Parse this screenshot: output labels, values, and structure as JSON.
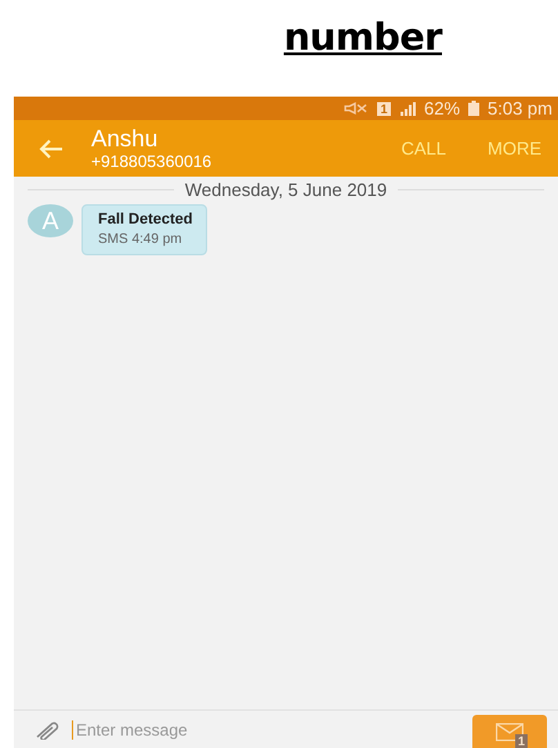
{
  "heading": "number",
  "status_bar": {
    "sim_slot": "1",
    "battery": "62%",
    "time": "5:03 pm"
  },
  "header": {
    "contact_name": "Anshu",
    "phone": "+918805360016",
    "actions": [
      "CALL",
      "MORE"
    ]
  },
  "date_separator": "Wednesday, 5 June 2019",
  "messages": [
    {
      "avatar": "A",
      "text": "Fall Detected",
      "meta": "SMS 4:49 pm"
    }
  ],
  "composer": {
    "placeholder": "Enter message",
    "send_badge": "1"
  }
}
